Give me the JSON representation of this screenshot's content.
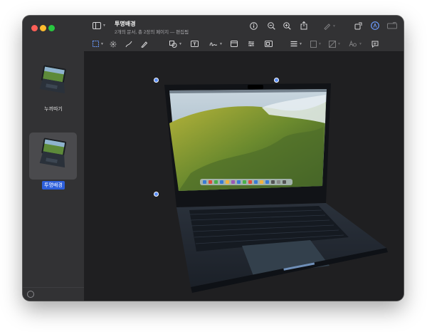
{
  "window": {
    "title": "투명배경",
    "subtitle": "2개의 문서, 총 2장의 페이지 — 편집됨"
  },
  "sidebar": {
    "items": [
      {
        "label": "누끼따기",
        "selected": false
      },
      {
        "label": "투명배경",
        "selected": true
      }
    ]
  },
  "toolbar": {
    "top_icons": [
      "sidebar-toggle-icon",
      "info-icon",
      "zoom-out-icon",
      "zoom-in-icon",
      "share-icon",
      "highlight-pen-icon",
      "rotate-icon",
      "markup-icon",
      "redact-icon",
      "search-icon"
    ],
    "markup_icons": [
      "selection-icon",
      "instant-alpha-icon",
      "sketch-icon",
      "draw-icon",
      "shapes-icon",
      "text-icon",
      "sign-icon",
      "note-icon",
      "adjust-color-icon",
      "adjust-size-icon",
      "shape-style-icon",
      "border-color-icon",
      "fill-color-icon",
      "text-style-icon",
      "description-icon"
    ]
  },
  "colors": {
    "accent": "#2d5fdb",
    "window_bg": "#2a2a2c",
    "canvas_bg": "#1f1f21",
    "handle": "#5a8df5"
  }
}
